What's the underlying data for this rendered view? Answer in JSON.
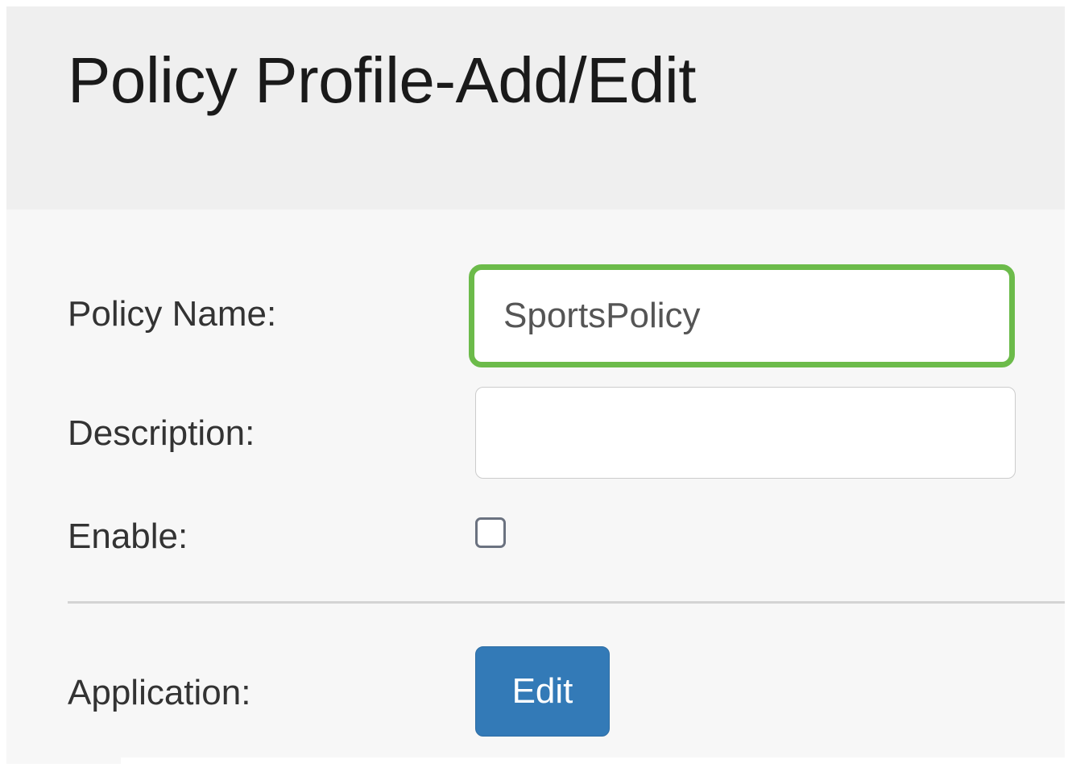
{
  "header": {
    "title": "Policy Profile-Add/Edit"
  },
  "form": {
    "policy_name": {
      "label": "Policy Name:",
      "value": "SportsPolicy"
    },
    "description": {
      "label": "Description:",
      "value": ""
    },
    "enable": {
      "label": "Enable:",
      "checked": false
    },
    "application": {
      "label": "Application:",
      "button_label": "Edit"
    }
  },
  "colors": {
    "focus_border": "#6cbb4a",
    "button_bg": "#337ab7",
    "header_bg": "#efefef"
  }
}
